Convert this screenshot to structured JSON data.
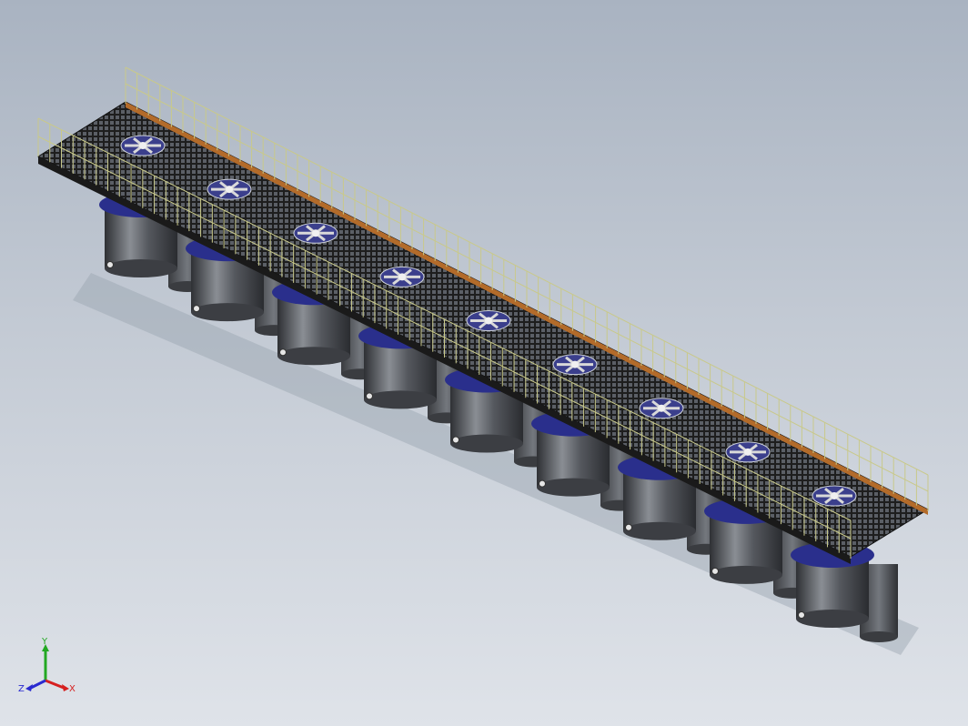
{
  "viewport": {
    "background_top": "#a9b3c1",
    "background_bottom": "#dfe3e9"
  },
  "model": {
    "description_icon": "cad-assembly-tank-row",
    "tank_count": 9,
    "colors": {
      "tank_body": "#4a4d52",
      "tank_highlight": "#8a8e94",
      "tank_flange": "#2a2f8c",
      "deck_grating": "#262626",
      "railing": "#c9c98a",
      "edge_trim": "#b36b2a",
      "impeller": "#d9d9d9"
    }
  },
  "triad": {
    "x_label": "X",
    "y_label": "Y",
    "z_label": "Z",
    "x_color": "#d62020",
    "y_color": "#22a822",
    "z_color": "#2a2ad0"
  }
}
